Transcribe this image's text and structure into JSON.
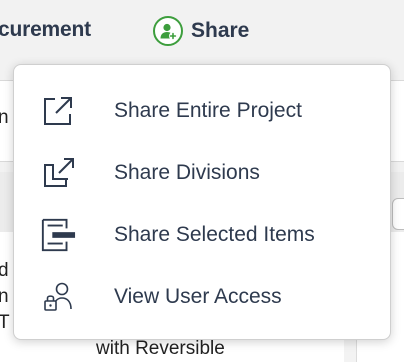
{
  "toolbar": {
    "procurement_label": "curement",
    "share_label": "Share",
    "share_icon": "user-add-icon",
    "share_icon_color": "#3d9e3d"
  },
  "background": {
    "row1_text": "n",
    "list_col_a": [
      "d",
      "n",
      "T"
    ],
    "list_col_b_text": "with Reversible"
  },
  "menu": {
    "items": [
      {
        "label": "Share Entire Project",
        "icon": "external-link-icon"
      },
      {
        "label": "Share Divisions",
        "icon": "multiple-windows-icon"
      },
      {
        "label": "Share Selected Items",
        "icon": "selected-items-icon"
      },
      {
        "label": "View User Access",
        "icon": "user-lock-icon"
      }
    ]
  },
  "colors": {
    "text_primary": "#2e3a4e",
    "accent_green": "#3d9e3d",
    "menu_bg": "#ffffff",
    "page_bg": "#f2f2f2"
  }
}
